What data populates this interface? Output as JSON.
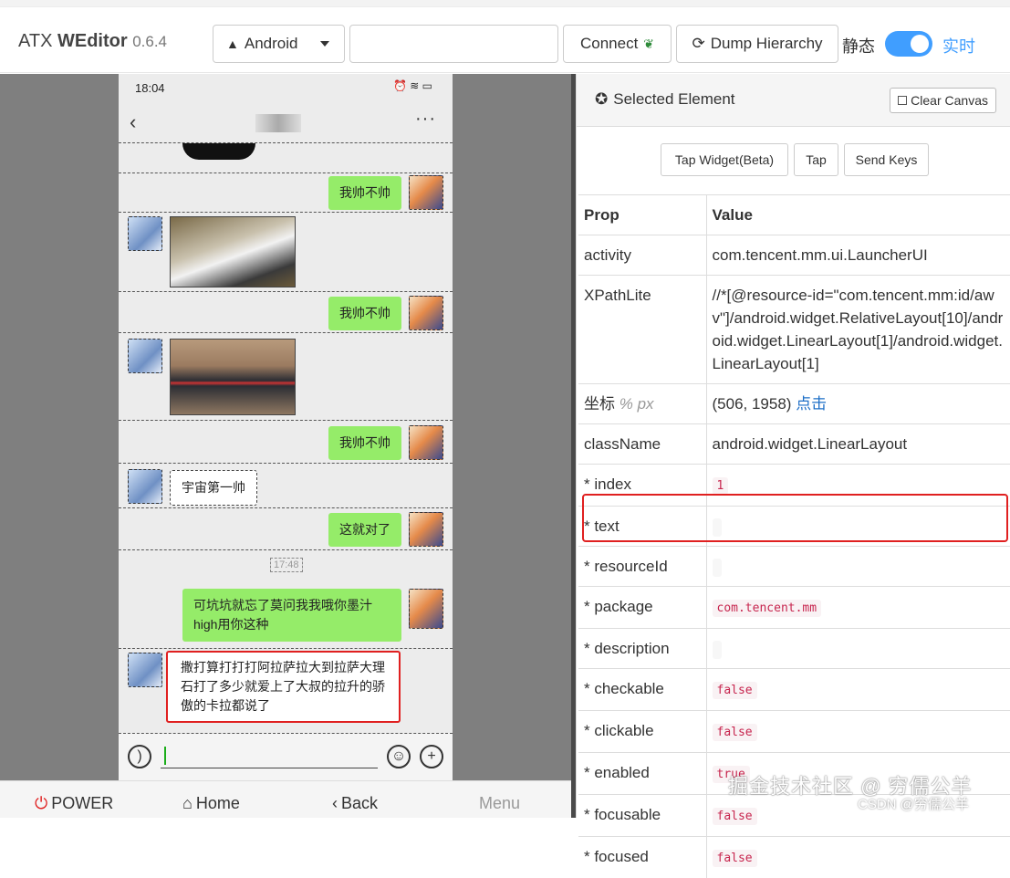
{
  "header": {
    "brand_prefix": "ATX",
    "brand_name": "WEditor",
    "version": "0.6.4",
    "platform": "Android",
    "serial_value": "",
    "connect_label": "Connect",
    "dump_label": "Dump Hierarchy",
    "static_label": "静态",
    "realtime_label": "实时",
    "realtime_on": true,
    "accent_color": "#409eff"
  },
  "device": {
    "status_time": "18:04",
    "status_extra": "⏰ ≋ ▭",
    "back_glyph": "‹",
    "more_glyph": "···",
    "messages": [
      {
        "from": "me",
        "type": "text",
        "text": "我帅不帅"
      },
      {
        "from": "other",
        "type": "image"
      },
      {
        "from": "me",
        "type": "text",
        "text": "我帅不帅"
      },
      {
        "from": "other",
        "type": "image"
      },
      {
        "from": "me",
        "type": "text",
        "text": "我帅不帅"
      },
      {
        "from": "other",
        "type": "text",
        "text": "宇宙第一帅"
      },
      {
        "from": "me",
        "type": "text",
        "text": "这就对了"
      },
      {
        "type": "time",
        "text": "17:48"
      },
      {
        "from": "me",
        "type": "text",
        "text": "可坑坑就忘了莫问我我哦你墨汁high用你这种"
      },
      {
        "from": "other",
        "type": "text",
        "text": "撒打算打打打阿拉萨拉大到拉萨大理石打了多少就爱上了大叔的拉升的骄傲的卡拉都说了",
        "selected": true
      }
    ],
    "nav": {
      "power": "POWER",
      "home": "Home",
      "back": "Back",
      "menu": "Menu"
    }
  },
  "panel": {
    "title": "Selected Element",
    "clear_canvas": "Clear Canvas",
    "tap_widget": "Tap Widget(Beta)",
    "tap": "Tap",
    "send_keys": "Send Keys",
    "col_prop": "Prop",
    "col_value": "Value",
    "activity_key": "activity",
    "activity": "com.tencent.mm.ui.LauncherUI",
    "xpath_key": "XPathLite",
    "xpath": "//*[@resource-id=\"com.tencent.mm:id/awv\"]/android.widget.RelativeLayout[10]/android.widget.LinearLayout[1]/android.widget.LinearLayout[1]",
    "coord_key": "坐标",
    "coord_unit": "% px",
    "coord_value": "(506, 1958)",
    "coord_link": "点击",
    "classname_key": "className",
    "classname": "android.widget.LinearLayout",
    "attrs": [
      {
        "key": "* index",
        "value": "1"
      },
      {
        "key": "* text",
        "value": ""
      },
      {
        "key": "* resourceId",
        "value": ""
      },
      {
        "key": "* package",
        "value": "com.tencent.mm"
      },
      {
        "key": "* description",
        "value": ""
      },
      {
        "key": "* checkable",
        "value": "false"
      },
      {
        "key": "* clickable",
        "value": "false"
      },
      {
        "key": "* enabled",
        "value": "true"
      },
      {
        "key": "* focusable",
        "value": "false"
      },
      {
        "key": "* focused",
        "value": "false"
      }
    ]
  },
  "watermark": {
    "line1": "掘金技术社区 @ 穷儒公羊",
    "line2": "CSDN @穷儒公羊"
  }
}
